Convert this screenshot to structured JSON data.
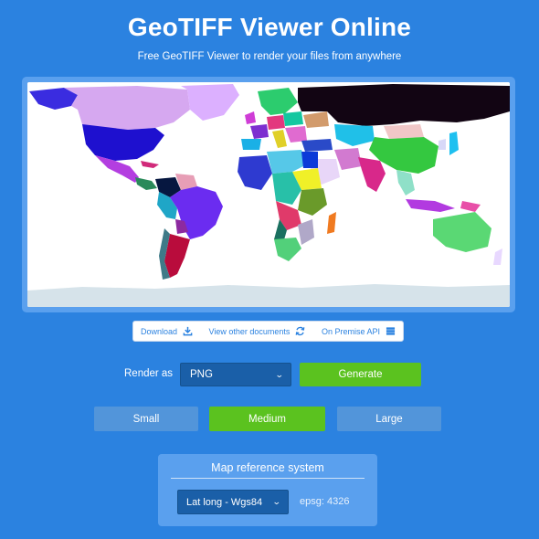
{
  "header": {
    "title": "GeoTIFF Viewer Online",
    "subtitle": "Free GeoTIFF Viewer to render your files from anywhere"
  },
  "map": {
    "icon": "world-map",
    "colors": {
      "ocean": "#ffffff",
      "antarctica": "#d6e3ea",
      "russia": "#120513",
      "canada": "#d6a8f0",
      "usa": "#1e10cf",
      "greenland": "#dcb0ff",
      "brazil": "#6b2cf0",
      "argentina": "#b90c3c",
      "china": "#34c840",
      "india": "#d8288a",
      "australia": "#5ad874"
    }
  },
  "toolbar": {
    "download_label": "Download",
    "view_docs_label": "View other documents",
    "on_premise_label": "On Premise API"
  },
  "render": {
    "label": "Render as",
    "format_selected": "PNG",
    "generate_label": "Generate"
  },
  "sizes": {
    "small": "Small",
    "medium": "Medium",
    "large": "Large",
    "selected": "Medium"
  },
  "reference": {
    "title": "Map reference system",
    "crs_selected": "Lat long - Wgs84",
    "epsg_text": "epsg: 4326"
  },
  "colors": {
    "background": "#2b82e0",
    "accent_green": "#5bc21f",
    "select_bg": "#1a5fa8",
    "panel_bg": "#5aa0ee"
  }
}
